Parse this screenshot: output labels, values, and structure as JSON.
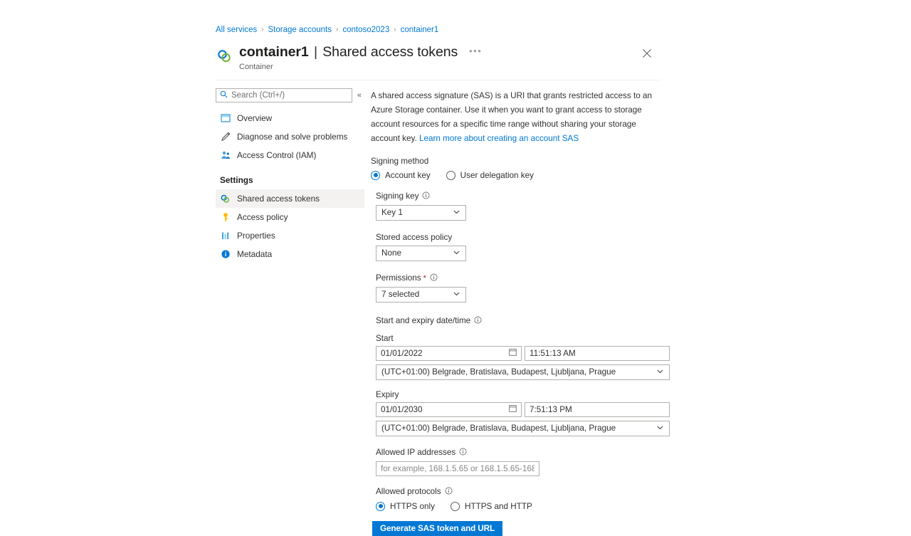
{
  "breadcrumb": {
    "items": [
      "All services",
      "Storage accounts",
      "contoso2023",
      "container1"
    ],
    "separator": "›"
  },
  "header": {
    "resource_name": "container1",
    "section_title": "Shared access tokens",
    "resource_type": "Container",
    "more_label": "•••",
    "icon": "container-rings-icon",
    "close_icon": "close-icon"
  },
  "nav": {
    "search": {
      "placeholder": "Search (Ctrl+/)",
      "value": "",
      "icon": "search-icon"
    },
    "collapse_icon": "chevron-double-left-icon",
    "items": [
      {
        "label": "Overview",
        "icon": "overview-icon",
        "selected": false
      },
      {
        "label": "Diagnose and solve problems",
        "icon": "wrench-icon",
        "selected": false
      },
      {
        "label": "Access Control (IAM)",
        "icon": "access-control-icon",
        "selected": false
      }
    ],
    "group_header": "Settings",
    "settings_items": [
      {
        "label": "Shared access tokens",
        "icon": "container-rings-icon",
        "selected": true
      },
      {
        "label": "Access policy",
        "icon": "key-icon",
        "selected": false
      },
      {
        "label": "Properties",
        "icon": "properties-bars-icon",
        "selected": false
      },
      {
        "label": "Metadata",
        "icon": "info-circle-icon",
        "selected": false
      }
    ]
  },
  "content": {
    "intro_text": "A shared access signature (SAS) is a URI that grants restricted access to an Azure Storage container. Use it when you want to grant access to storage account resources for a specific time range without sharing your storage account key. ",
    "intro_link": "Learn more about creating an account SAS",
    "signing_method": {
      "label": "Signing method",
      "options": [
        {
          "label": "Account key",
          "selected": true
        },
        {
          "label": "User delegation key",
          "selected": false
        }
      ]
    },
    "signing_key": {
      "label": "Signing key",
      "value": "Key 1",
      "info_icon": "info-icon",
      "chevron_icon": "chevron-down-icon"
    },
    "stored_access_policy": {
      "label": "Stored access policy",
      "value": "None",
      "chevron_icon": "chevron-down-icon"
    },
    "permissions": {
      "label": "Permissions",
      "required_marker": "*",
      "value": "7 selected",
      "info_icon": "info-icon",
      "chevron_icon": "chevron-down-icon"
    },
    "date_time": {
      "label": "Start and expiry date/time",
      "info_icon": "info-icon",
      "start": {
        "label": "Start",
        "date": "01/01/2022",
        "time": "11:51:13 AM",
        "timezone": "(UTC+01:00) Belgrade, Bratislava, Budapest, Ljubljana, Prague",
        "calendar_icon": "calendar-icon"
      },
      "expiry": {
        "label": "Expiry",
        "date": "01/01/2030",
        "time": "7:51:13 PM",
        "timezone": "(UTC+01:00) Belgrade, Bratislava, Budapest, Ljubljana, Prague",
        "calendar_icon": "calendar-icon"
      }
    },
    "allowed_ip": {
      "label": "Allowed IP addresses",
      "value": "",
      "placeholder": "for example, 168.1.5.65 or 168.1.5.65-168.1....",
      "info_icon": "info-icon"
    },
    "allowed_protocols": {
      "label": "Allowed protocols",
      "info_icon": "info-icon",
      "options": [
        {
          "label": "HTTPS only",
          "selected": true
        },
        {
          "label": "HTTPS and HTTP",
          "selected": false
        }
      ]
    },
    "generate_button": "Generate SAS token and URL"
  },
  "colors": {
    "accent": "#0078d4",
    "link": "#0078d4",
    "required": "#a4262c",
    "selected_row": "#f3f2f1",
    "key_icon": "#ffb900",
    "text": "#323130"
  }
}
